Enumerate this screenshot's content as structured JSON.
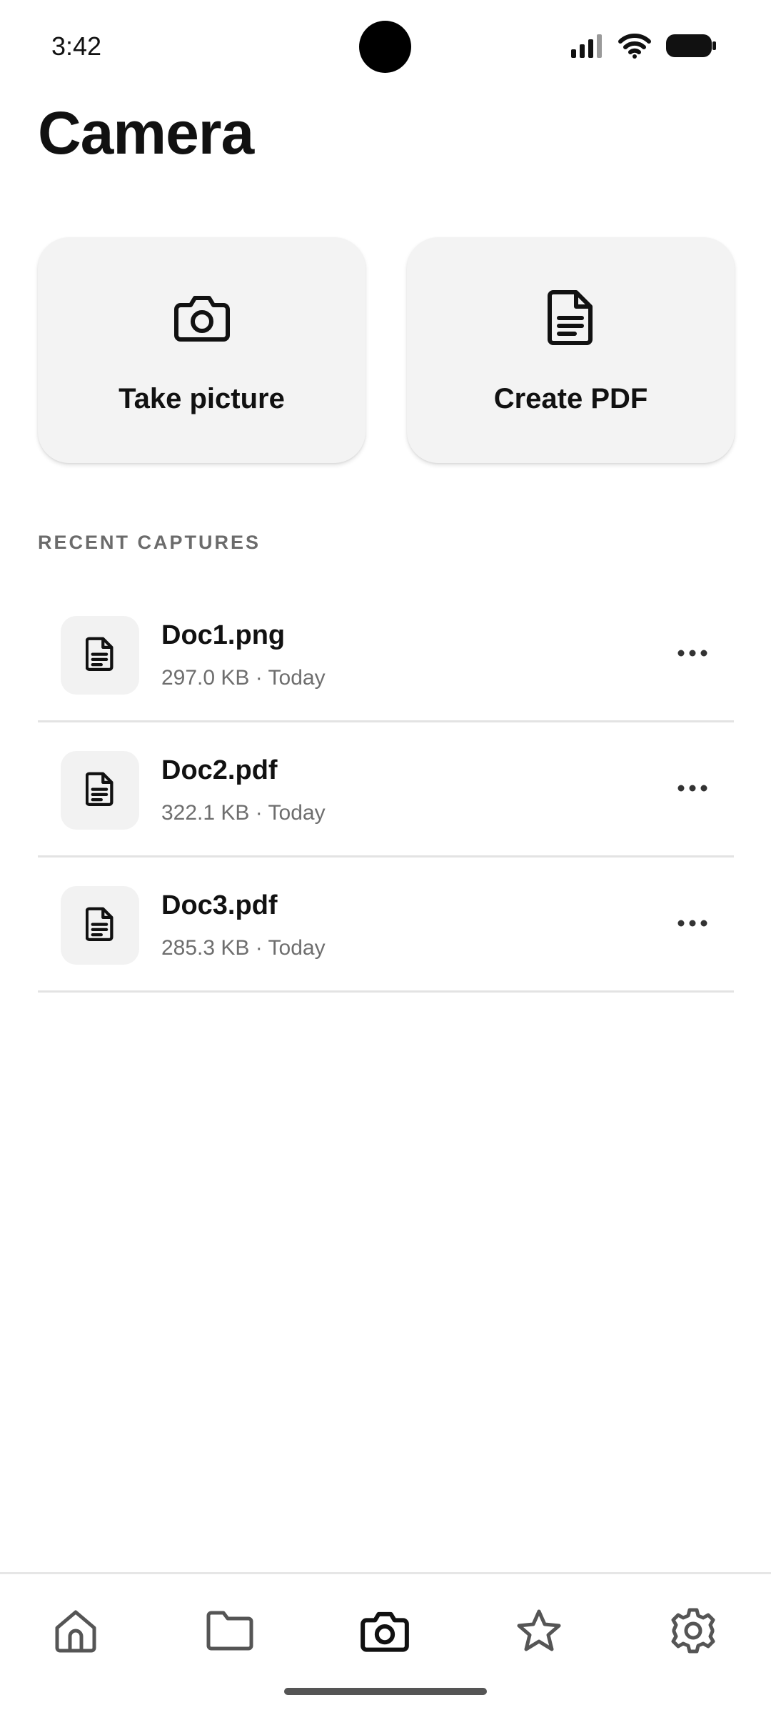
{
  "status_bar": {
    "time": "3:42",
    "icons": [
      "signal-icon",
      "wifi-icon",
      "battery-icon"
    ]
  },
  "title": "Camera",
  "actions": [
    {
      "label": "Take picture",
      "icon": "camera-icon"
    },
    {
      "label": "Create PDF",
      "icon": "document-icon"
    }
  ],
  "recent": {
    "heading": "RECENT CAPTURES",
    "items": [
      {
        "name": "Doc1.png",
        "meta": "297.0 KB · Today",
        "icon": "document-icon"
      },
      {
        "name": "Doc2.pdf",
        "meta": "322.1 KB · Today",
        "icon": "document-icon"
      },
      {
        "name": "Doc3.pdf",
        "meta": "285.3 KB · Today",
        "icon": "document-icon"
      }
    ]
  },
  "nav": {
    "items": [
      "home-icon",
      "folder-icon",
      "camera-icon",
      "star-icon",
      "gear-icon"
    ],
    "active": "camera-icon"
  },
  "colors": {
    "text": "#111111",
    "muted": "#6e6e6e",
    "card": "#f3f3f3",
    "divider": "#e3e3e3",
    "nav_inactive": "#555555"
  }
}
